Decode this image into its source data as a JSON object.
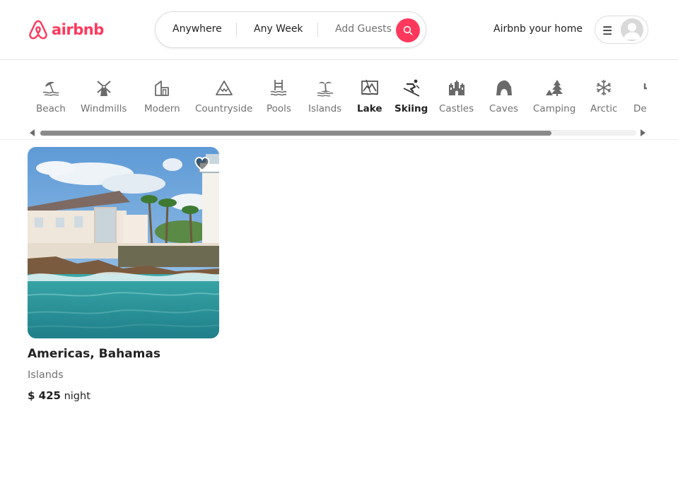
{
  "brand": {
    "name": "airbnb",
    "color": "#ff385c",
    "logo_icon": "airbnb-belo-icon"
  },
  "search": {
    "anywhere": "Anywhere",
    "week": "Any Week",
    "guests": "Add Guests",
    "button_icon": "search-icon"
  },
  "header": {
    "host_link": "Airbnb your home",
    "menu_icon": "hamburger-icon",
    "avatar_icon": "user-avatar-icon"
  },
  "categories": [
    {
      "label": "Beach",
      "icon": "beach-icon"
    },
    {
      "label": "Windmills",
      "icon": "windmill-icon"
    },
    {
      "label": "Modern",
      "icon": "modern-house-icon"
    },
    {
      "label": "Countryside",
      "icon": "mountain-icon"
    },
    {
      "label": "Pools",
      "icon": "pool-icon"
    },
    {
      "label": "Islands",
      "icon": "island-icon"
    },
    {
      "label": "Lake",
      "icon": "lake-icon"
    },
    {
      "label": "Skiing",
      "icon": "skiing-icon"
    },
    {
      "label": "Castles",
      "icon": "castle-icon"
    },
    {
      "label": "Caves",
      "icon": "cave-icon"
    },
    {
      "label": "Camping",
      "icon": "camping-icon"
    },
    {
      "label": "Arctic",
      "icon": "snowflake-icon"
    },
    {
      "label": "Desert",
      "icon": "cactus-icon"
    }
  ],
  "listing": {
    "title": "Americas, Bahamas",
    "category": "Islands",
    "price": "$ 425",
    "unit": "night",
    "heart_icon": "heart-icon"
  }
}
